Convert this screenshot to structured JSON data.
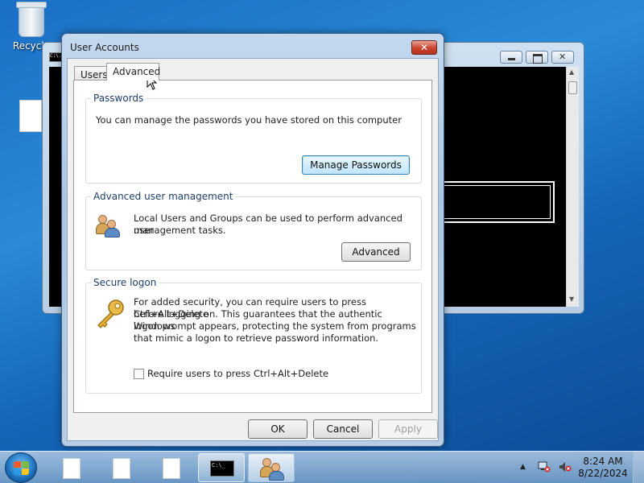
{
  "desktop": {
    "recycle_label": "Recycle"
  },
  "console": {
    "icon_text": "C:\\."
  },
  "dialog": {
    "title": "User Accounts",
    "close_symbol": "✕",
    "tabs": [
      {
        "label": "Users",
        "selected": false
      },
      {
        "label": "Advanced",
        "selected": true
      }
    ],
    "passwords": {
      "title": "Passwords",
      "text": "You can manage the passwords you have stored on this computer",
      "button": "Manage Passwords"
    },
    "advanced_mgmt": {
      "title": "Advanced user management",
      "text_line1": "Local Users and Groups can be used to perform advanced user",
      "text_line2": "management tasks.",
      "button": "Advanced"
    },
    "secure_logon": {
      "title": "Secure logon",
      "text_line1": "For added security, you can require users to press Ctrl+Alt+Delete",
      "text_line2": "before logging on. This guarantees that the authentic Windows",
      "text_line3": "logon prompt appears, protecting the system from programs",
      "text_line4": "that mimic a logon to retrieve password information.",
      "checkbox_label": "Require users to press Ctrl+Alt+Delete",
      "checkbox_checked": false
    },
    "footer": {
      "ok": "OK",
      "cancel": "Cancel",
      "apply": "Apply"
    }
  },
  "taskbar": {
    "cmd_text": "C:\\_",
    "time": "8:24 AM",
    "date": "8/22/2024"
  },
  "colors": {
    "desktop_bg": "#1a6fc4",
    "group_title": "#1e3e6b",
    "close_red": "#c9452f"
  }
}
